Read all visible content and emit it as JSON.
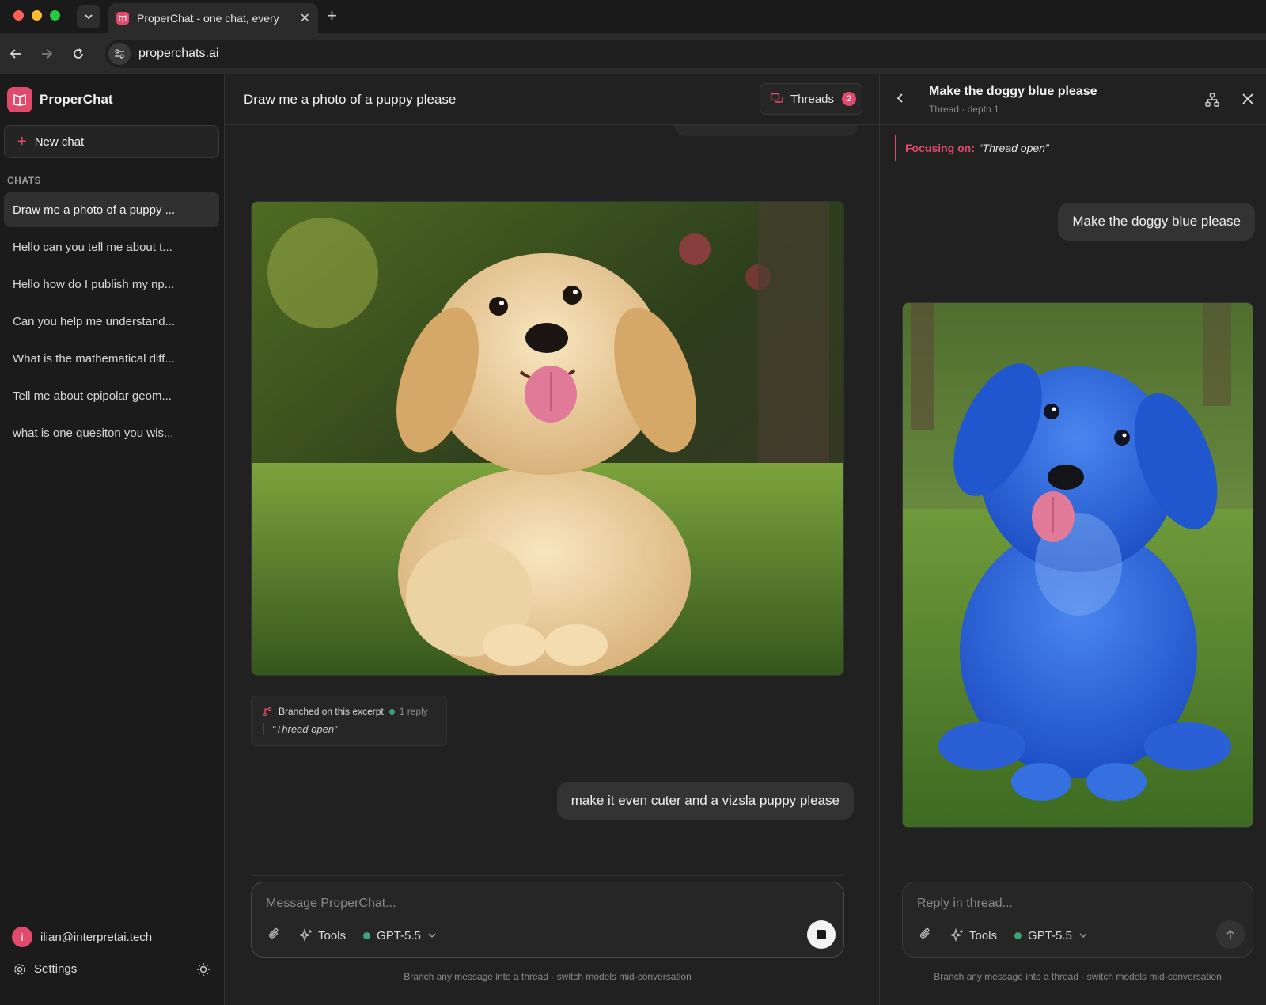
{
  "browser": {
    "tab_title": "ProperChat - one chat, every",
    "url": "properchats.ai"
  },
  "sidebar": {
    "brand": "ProperChat",
    "new_chat_label": "New chat",
    "chats_heading": "CHATS",
    "chats": [
      {
        "label": "Draw me a photo of a puppy ..."
      },
      {
        "label": "Hello can you tell me about t..."
      },
      {
        "label": "Hello how do I publish my np..."
      },
      {
        "label": "Can you help me understand..."
      },
      {
        "label": "What is the mathematical diff..."
      },
      {
        "label": "Tell me about epipolar geom..."
      },
      {
        "label": "what is one quesiton you wis..."
      }
    ],
    "user_initial": "i",
    "user_email": "ilian@interpretai.tech",
    "settings_label": "Settings"
  },
  "main": {
    "title": "Draw me a photo of a puppy please",
    "threads_label": "Threads",
    "threads_count": "2",
    "branch": {
      "label": "Branched on this excerpt",
      "reply_count": "1 reply",
      "quote": "“Thread open”"
    },
    "user_message": "make it even cuter and a vizsla puppy please",
    "composer": {
      "placeholder": "Message ProperChat...",
      "tools_label": "Tools",
      "model": "GPT-5.5"
    },
    "footer_note": "Branch any message into a thread · switch models mid-conversation"
  },
  "thread": {
    "title": "Make the doggy blue please",
    "subtitle": "Thread · depth 1",
    "focus_label": "Focusing on:",
    "focus_quote": "“Thread open”",
    "user_message": "Make the doggy blue please",
    "composer": {
      "placeholder": "Reply in thread...",
      "tools_label": "Tools",
      "model": "GPT-5.5"
    },
    "footer_note": "Branch any message into a thread · switch models mid-conversation"
  },
  "colors": {
    "accent": "#e14a6a",
    "model_dot": "#3ea37a",
    "background": "#212121"
  }
}
